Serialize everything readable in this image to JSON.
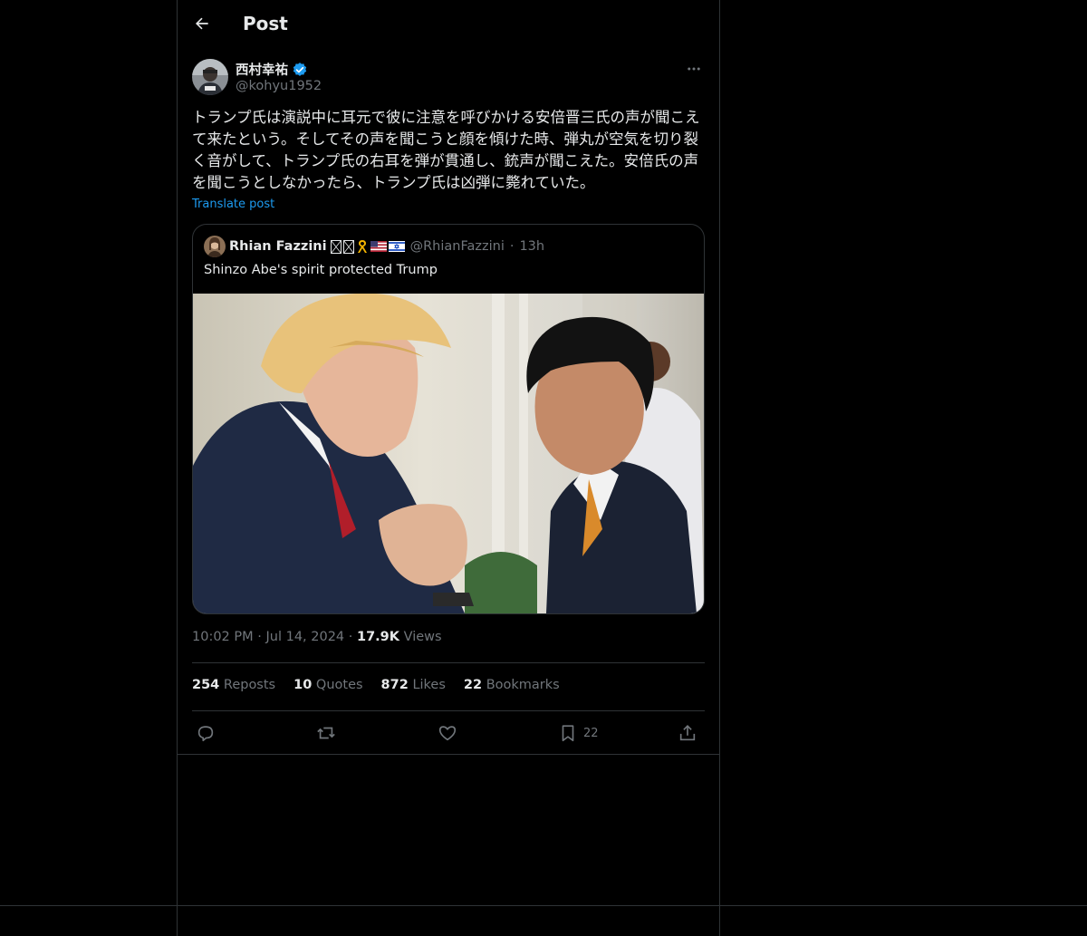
{
  "header": {
    "title": "Post"
  },
  "post": {
    "author_name": "西村幸祐",
    "author_handle": "@kohyu1952",
    "text": "トランプ氏は演説中に耳元で彼に注意を呼びかける安倍晋三氏の声が聞こえて来たという。そしてその声を聞こうと顔を傾けた時、弾丸が空気を切り裂く音がして、トランプ氏の右耳を弾が貫通し、銃声が聞こえた。安倍氏の声を聞こうとしなかったら、トランプ氏は凶弾に斃れていた。",
    "translate_label": "Translate post",
    "time": "10:02 PM",
    "date": "Jul 14, 2024",
    "views_count": "17.9K",
    "views_label": "Views"
  },
  "quote": {
    "author_name": "Rhian Fazzini",
    "author_handle": "@RhianFazzini",
    "time": "13h",
    "text": "Shinzo Abe's spirit protected Trump",
    "image_alt": "Photo of two men clasping hands"
  },
  "stats": {
    "reposts_count": "254",
    "reposts_label": "Reposts",
    "quotes_count": "10",
    "quotes_label": "Quotes",
    "likes_count": "872",
    "likes_label": "Likes",
    "bookmarks_count": "22",
    "bookmarks_label": "Bookmarks"
  },
  "actions": {
    "reply_icon": "reply-icon",
    "repost_icon": "repost-icon",
    "like_icon": "heart-icon",
    "bookmark_icon": "bookmark-icon",
    "bookmark_count": "22",
    "share_icon": "share-icon"
  },
  "colors": {
    "background": "#000000",
    "text": "#e7e9ea",
    "muted": "#71767b",
    "accent": "#1d9bf0",
    "border": "#2f3336"
  }
}
